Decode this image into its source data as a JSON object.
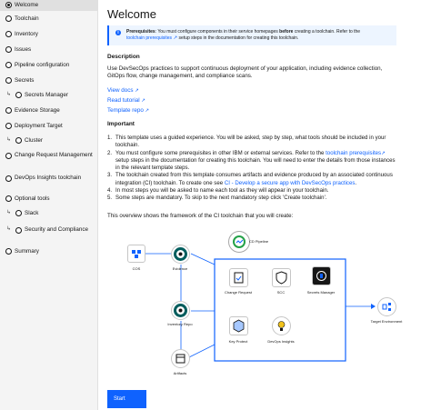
{
  "sidebar": {
    "items": [
      {
        "label": "Welcome",
        "active": true
      },
      {
        "label": "Toolchain"
      },
      {
        "label": "Inventory"
      },
      {
        "label": "Issues"
      },
      {
        "label": "Pipeline configuration"
      },
      {
        "label": "Secrets"
      },
      {
        "label": "Secrets Manager"
      },
      {
        "label": "Evidence Storage"
      },
      {
        "label": "Deployment Target"
      },
      {
        "label": "Cluster"
      },
      {
        "label": "Change Request Management"
      },
      {
        "label": "DevOps Insights toolchain"
      },
      {
        "label": "Optional tools"
      },
      {
        "label": "Slack"
      },
      {
        "label": "Security and Compliance"
      },
      {
        "label": "Summary"
      }
    ]
  },
  "main": {
    "title": "Welcome",
    "notice": {
      "bold": "Prerequisites",
      "text1": ": You must configure components in their service homepages ",
      "bold2": "before",
      "text2": " creating a toolchain. Refer to the",
      "link": "toolchain prerequisites",
      "text3": " setup steps in the documentation for creating this toolchain."
    },
    "description_heading": "Description",
    "description": "Use DevSecOps practices to support continuous deployment of your application, including evidence collection, GitOps flow, change management, and compliance scans.",
    "links": [
      "View docs",
      "Read tutorial",
      "Template repo"
    ],
    "important_heading": "Important",
    "steps": [
      {
        "n": "1.",
        "text": "This template uses a guided experience. You will be asked, step by step, what tools should be included in your toolchain."
      },
      {
        "n": "2.",
        "pre": "You must configure some prerequisites in other IBM or external services. Refer to the ",
        "link": "toolchain prerequisites",
        "post": " setup steps in the documentation for creating this toolchain. You will need to enter the details from those instances in the relevant template steps."
      },
      {
        "n": "3.",
        "pre": "The toolchain created from this template consumes artifacts and evidence produced by an associated continuous integration (CI) toolchain. To create one see ",
        "link": "CI - Develop a secure app with DevSecOps practices",
        "post": "."
      },
      {
        "n": "4.",
        "text": "In most steps you will be asked to name each tool as they will appear in your toolchain."
      },
      {
        "n": "5.",
        "text": "Some steps are mandatory. To skip to the next mandatory step click 'Create toolchain'."
      }
    ],
    "overview": "This overview shows the framework of the CI toolchain that you will create:",
    "diagram": {
      "cd_pipeline": "CD Pipeline",
      "cos": "COS",
      "evidence": "Evidence",
      "inventory": "Inventory Repo",
      "artifacts": "Artifacts",
      "change_request": "Change Request",
      "scc": "SCC",
      "secrets_manager": "Secrets Manager",
      "key_protect": "Key Protect",
      "devops_insights": "DevOps Insights",
      "target": "Target Environment"
    },
    "start_label": "Start"
  },
  "colors": {
    "accent": "#0f62fe",
    "sidebar_bg": "#f4f4f4",
    "notice_bg": "#edf5ff"
  }
}
